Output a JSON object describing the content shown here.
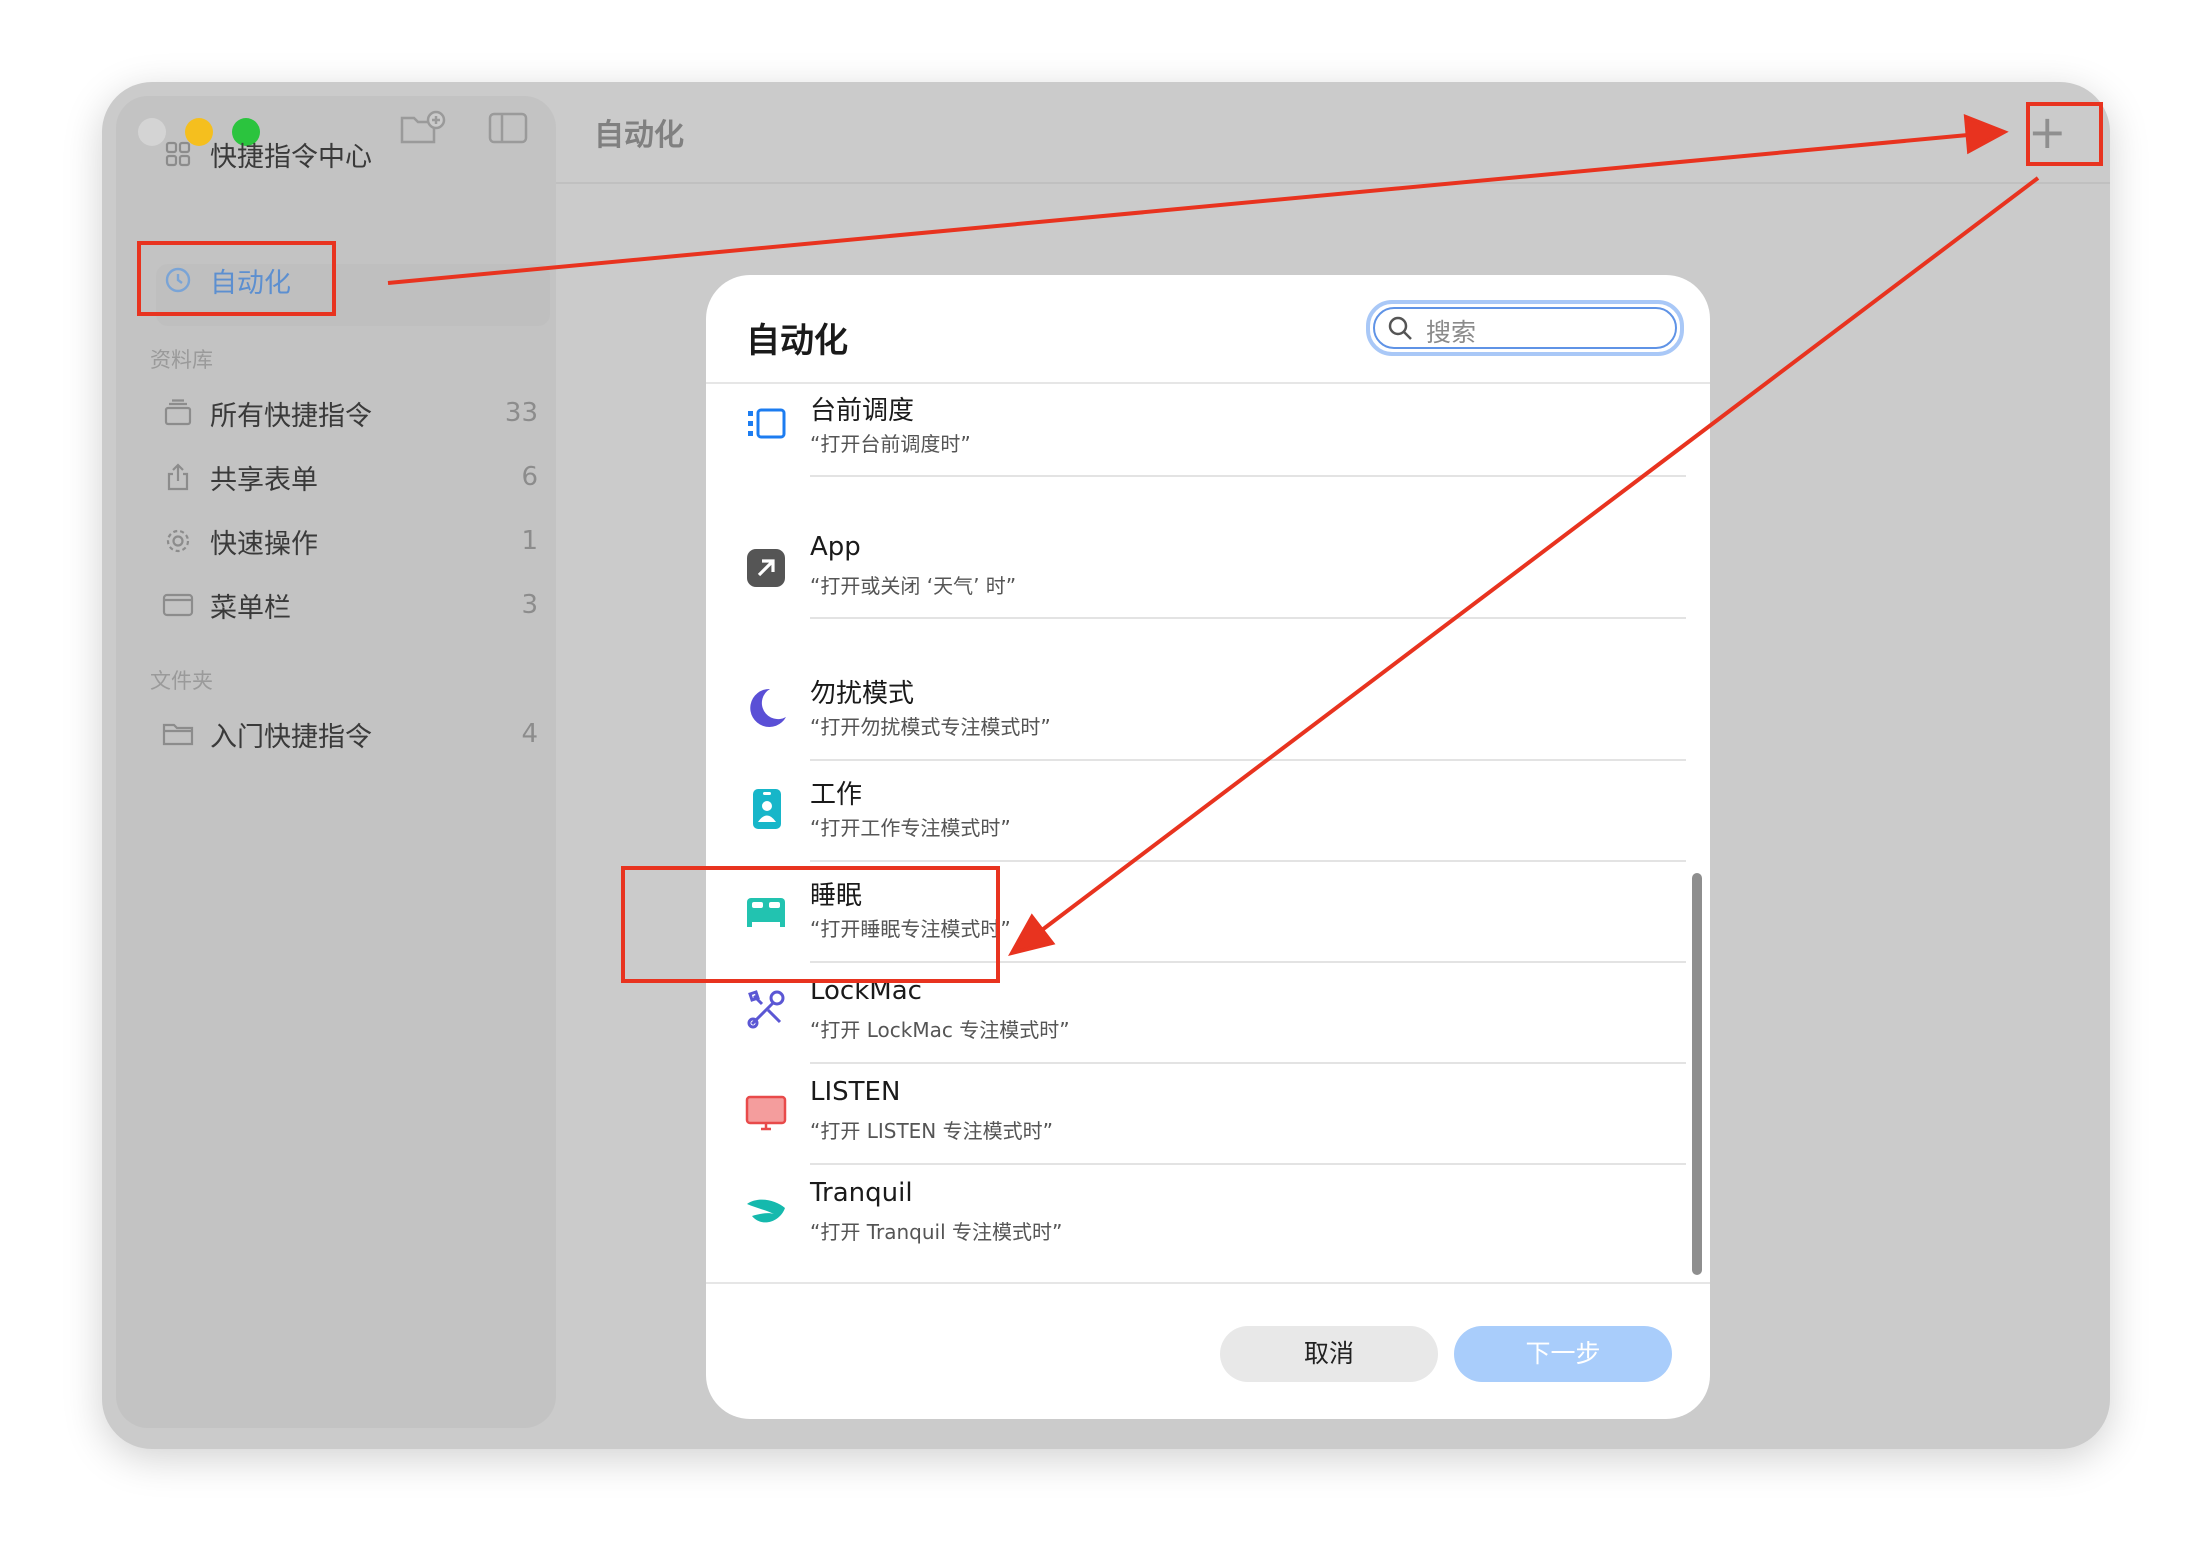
{
  "window": {
    "traffic_lights": {
      "close": "#d4d4d4",
      "minimize": "#f5bf1e",
      "zoom": "#2bc43e"
    },
    "toolbar_icons": [
      "new-folder-icon",
      "sidebar-toggle-icon"
    ],
    "title": "自动化",
    "add_button": "+"
  },
  "sidebar": {
    "top_items": [
      {
        "label": "快捷指令中心",
        "icon": "gallery-grid-icon"
      },
      {
        "label": "自动化",
        "icon": "automation-clock-icon",
        "selected": true
      }
    ],
    "library_label": "资料库",
    "library_items": [
      {
        "label": "所有快捷指令",
        "count": "33",
        "icon": "stack-icon"
      },
      {
        "label": "共享表单",
        "count": "6",
        "icon": "share-icon"
      },
      {
        "label": "快速操作",
        "count": "1",
        "icon": "gear-icon"
      },
      {
        "label": "菜单栏",
        "count": "3",
        "icon": "menubar-icon"
      }
    ],
    "folders_label": "文件夹",
    "folder_items": [
      {
        "label": "入门快捷指令",
        "count": "4",
        "icon": "folder-icon"
      }
    ]
  },
  "modal": {
    "title": "自动化",
    "search_placeholder": "搜索",
    "rows": [
      {
        "title": "台前调度",
        "subtitle": "“打开台前调度时”",
        "icon": "stage-manager-icon",
        "color": "#1c7cf0"
      },
      {
        "title": "App",
        "subtitle": "“打开或关闭 ‘天气’ 时”",
        "icon": "app-arrow-icon",
        "color": "#555555"
      },
      {
        "title": "勿扰模式",
        "subtitle": "“打开勿扰模式专注模式时”",
        "icon": "moon-icon",
        "color": "#5a4fd6"
      },
      {
        "title": "工作",
        "subtitle": "“打开工作专注模式时”",
        "icon": "work-badge-icon",
        "color": "#17b6c9"
      },
      {
        "title": "睡眠",
        "subtitle": "“打开睡眠专注模式时”",
        "icon": "bed-icon",
        "color": "#22c3b0"
      },
      {
        "title": "LockMac",
        "subtitle": "“打开 LockMac 专注模式时”",
        "icon": "tools-icon",
        "color": "#5b57d4"
      },
      {
        "title": "LISTEN",
        "subtitle": "“打开 LISTEN 专注模式时”",
        "icon": "display-icon",
        "color": "#e84a4a"
      },
      {
        "title": "Tranquil",
        "subtitle": "“打开 Tranquil 专注模式时”",
        "icon": "leaf-icon",
        "color": "#15b9ad"
      }
    ],
    "cancel_label": "取消",
    "next_label": "下一步"
  },
  "annotation_color": "#e8331f"
}
